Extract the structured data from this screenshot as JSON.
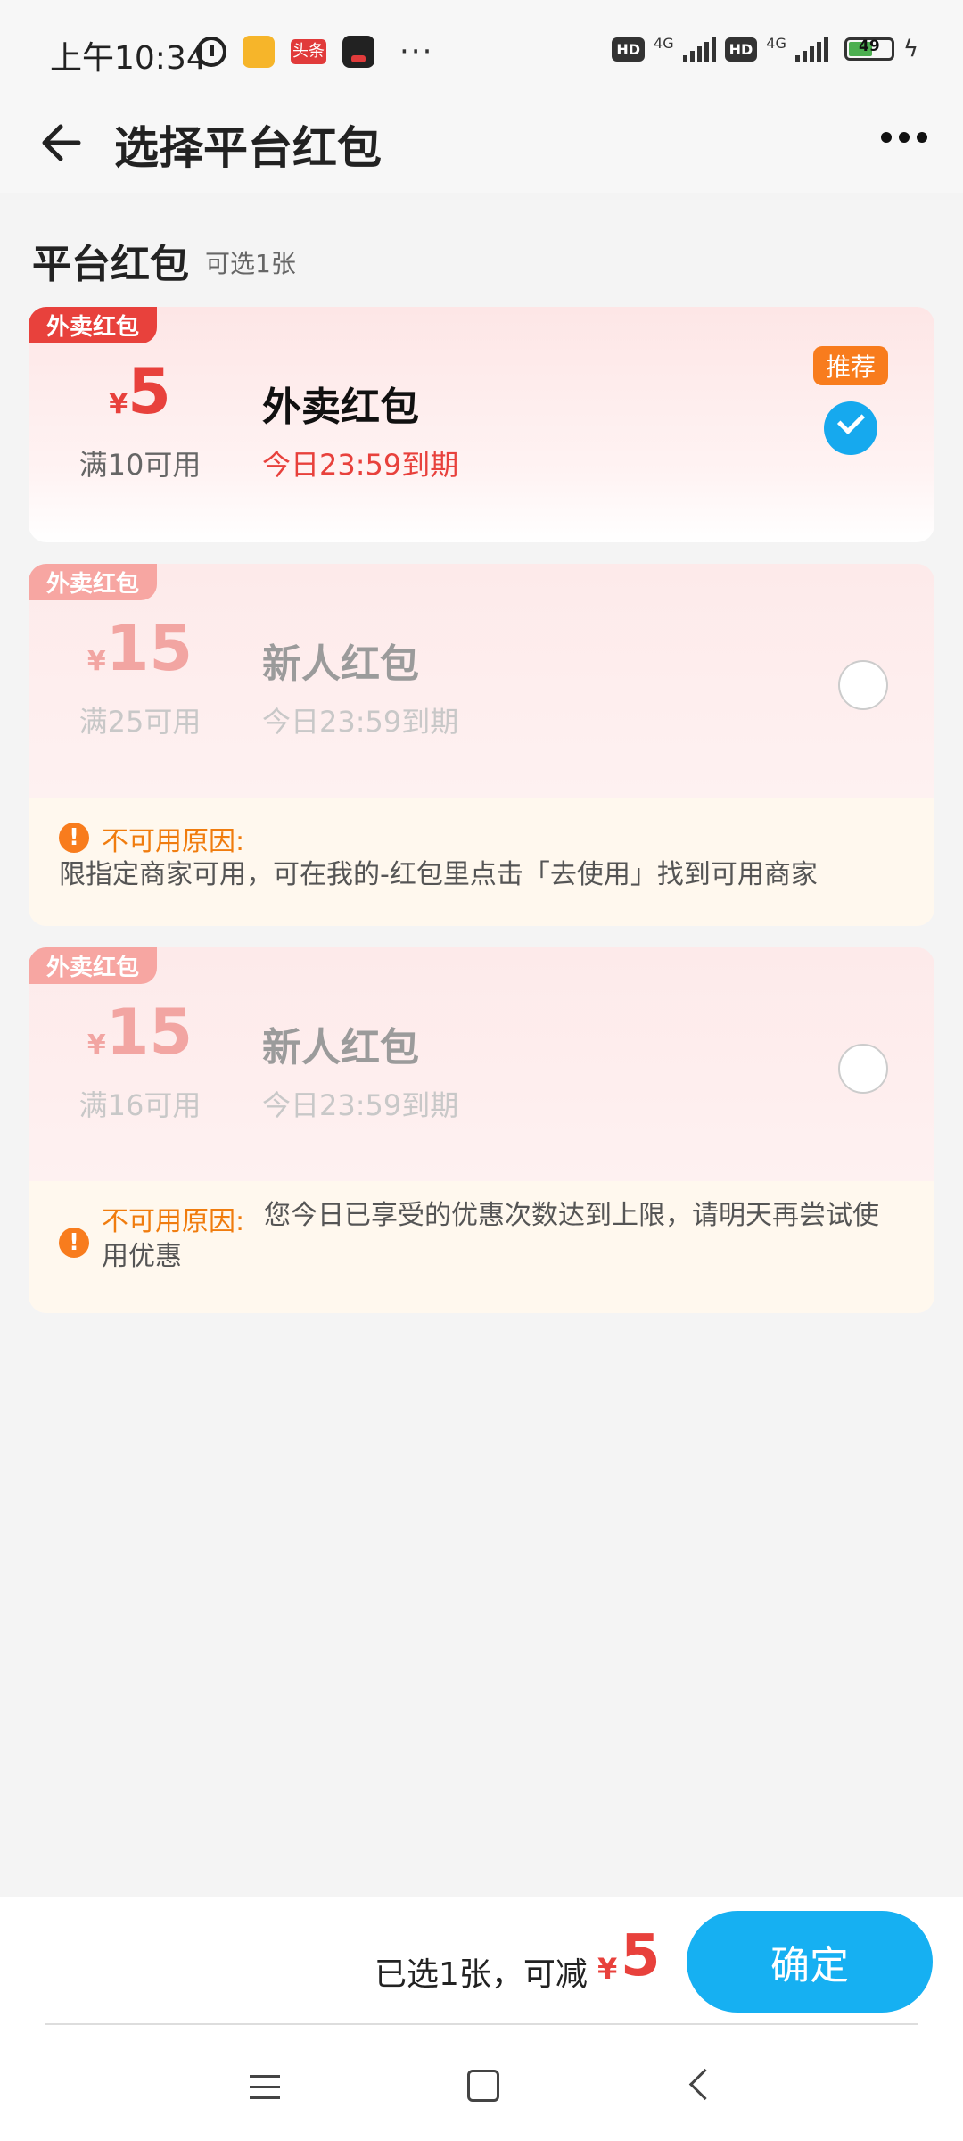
{
  "status_bar": {
    "time": "上午10:34",
    "app_tag": "头条",
    "more": "···",
    "hd1": "HD",
    "net1": "4G",
    "hd2": "HD",
    "net2": "4G",
    "battery": "49"
  },
  "header": {
    "title": "选择平台红包"
  },
  "section": {
    "title": "平台红包",
    "hint": "可选1张"
  },
  "coupons": [
    {
      "tag": "外卖红包",
      "currency": "¥",
      "amount": "5",
      "condition": "满10可用",
      "name": "外卖红包",
      "expire": "今日23:59到期",
      "badge": "推荐",
      "selected": true
    },
    {
      "tag": "外卖红包",
      "currency": "¥",
      "amount": "15",
      "condition": "满25可用",
      "name": "新人红包",
      "expire": "今日23:59到期",
      "reason_label": "不可用原因:",
      "reason_text": "限指定商家可用，可在我的-红包里点击「去使用」找到可用商家"
    },
    {
      "tag": "外卖红包",
      "currency": "¥",
      "amount": "15",
      "condition": "满16可用",
      "name": "新人红包",
      "expire": "今日23:59到期",
      "reason_label": "不可用原因:",
      "reason_text_line1": "您今日已享受的优惠次数达到上限，请明天再尝试使",
      "reason_text_line2": "用优惠"
    }
  ],
  "footer": {
    "selected_text": "已选1张，可减",
    "currency": "¥",
    "amount": "5",
    "confirm_label": "确定"
  }
}
